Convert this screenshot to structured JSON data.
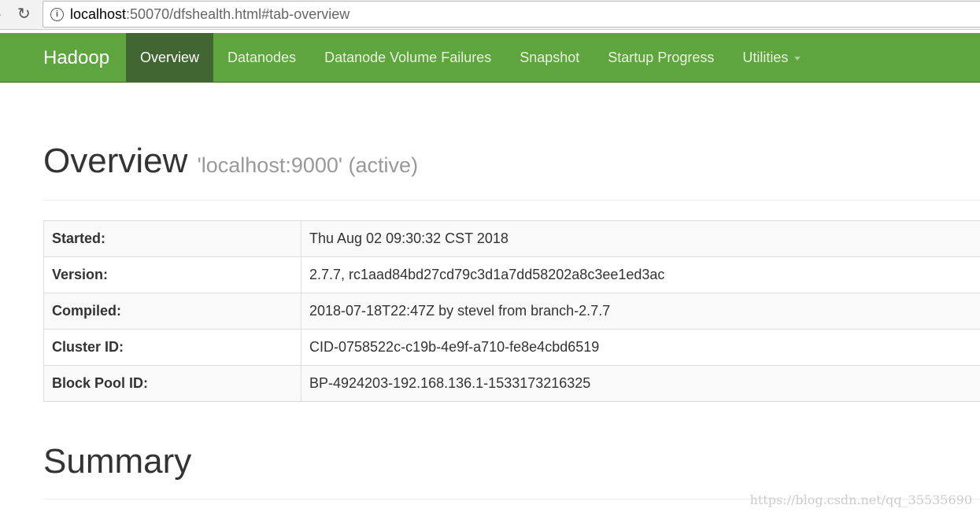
{
  "browser": {
    "url_host": "localhost",
    "url_rest": ":50070/dfshealth.html#tab-overview"
  },
  "nav": {
    "brand": "Hadoop",
    "tabs": [
      {
        "label": "Overview"
      },
      {
        "label": "Datanodes"
      },
      {
        "label": "Datanode Volume Failures"
      },
      {
        "label": "Snapshot"
      },
      {
        "label": "Startup Progress"
      },
      {
        "label": "Utilities"
      }
    ]
  },
  "overview": {
    "title": "Overview",
    "subtitle": "'localhost:9000' (active)",
    "rows": [
      {
        "key": "Started:",
        "value": "Thu Aug 02 09:30:32 CST 2018"
      },
      {
        "key": "Version:",
        "value": "2.7.7, rc1aad84bd27cd79c3d1a7dd58202a8c3ee1ed3ac"
      },
      {
        "key": "Compiled:",
        "value": "2018-07-18T22:47Z by stevel from branch-2.7.7"
      },
      {
        "key": "Cluster ID:",
        "value": "CID-0758522c-c19b-4e9f-a710-fe8e4cbd6519"
      },
      {
        "key": "Block Pool ID:",
        "value": "BP-4924203-192.168.136.1-1533173216325"
      }
    ]
  },
  "summary": {
    "title": "Summary"
  },
  "watermark": "https://blog.csdn.net/qq_35535690"
}
